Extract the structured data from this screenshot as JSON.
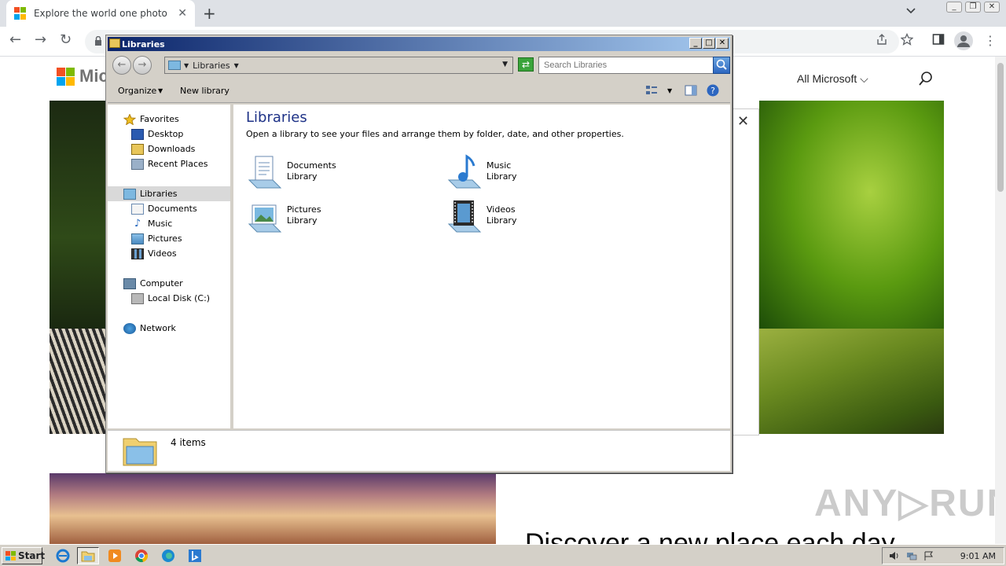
{
  "browser": {
    "tab_title": "Explore the world one photo at a time",
    "tab_close": "✕",
    "new_tab": "+",
    "back": "←",
    "forward": "→",
    "reload": "↻"
  },
  "webpage": {
    "brand_text": "Mic",
    "all_microsoft": "All Microsoft ⌵",
    "heading": "Discover a new place each day",
    "watermark": "ANY▷RUN",
    "close_glyph": "✕"
  },
  "explorer": {
    "title": "Libraries",
    "address": "Libraries",
    "search_placeholder": "Search Libraries",
    "organize": "Organize",
    "new_library": "New library",
    "nav": {
      "favorites": "Favorites",
      "desktop": "Desktop",
      "downloads": "Downloads",
      "recent_places": "Recent Places",
      "libraries": "Libraries",
      "documents": "Documents",
      "music": "Music",
      "pictures": "Pictures",
      "videos": "Videos",
      "computer": "Computer",
      "local_disk": "Local Disk (C:)",
      "network": "Network"
    },
    "heading": "Libraries",
    "description": "Open a library to see your files and arrange them by folder, date, and other properties.",
    "libraries": [
      {
        "name": "Documents",
        "sub": "Library"
      },
      {
        "name": "Music",
        "sub": "Library"
      },
      {
        "name": "Pictures",
        "sub": "Library"
      },
      {
        "name": "Videos",
        "sub": "Library"
      }
    ],
    "item_count": "4 items"
  },
  "taskbar": {
    "start": "Start",
    "clock": "9:01 AM"
  },
  "colors": {
    "title_gradient_start": "#0a246a",
    "title_gradient_end": "#a6caf0",
    "heading_blue": "#1e3287",
    "classic_gray": "#d4d0c8"
  }
}
